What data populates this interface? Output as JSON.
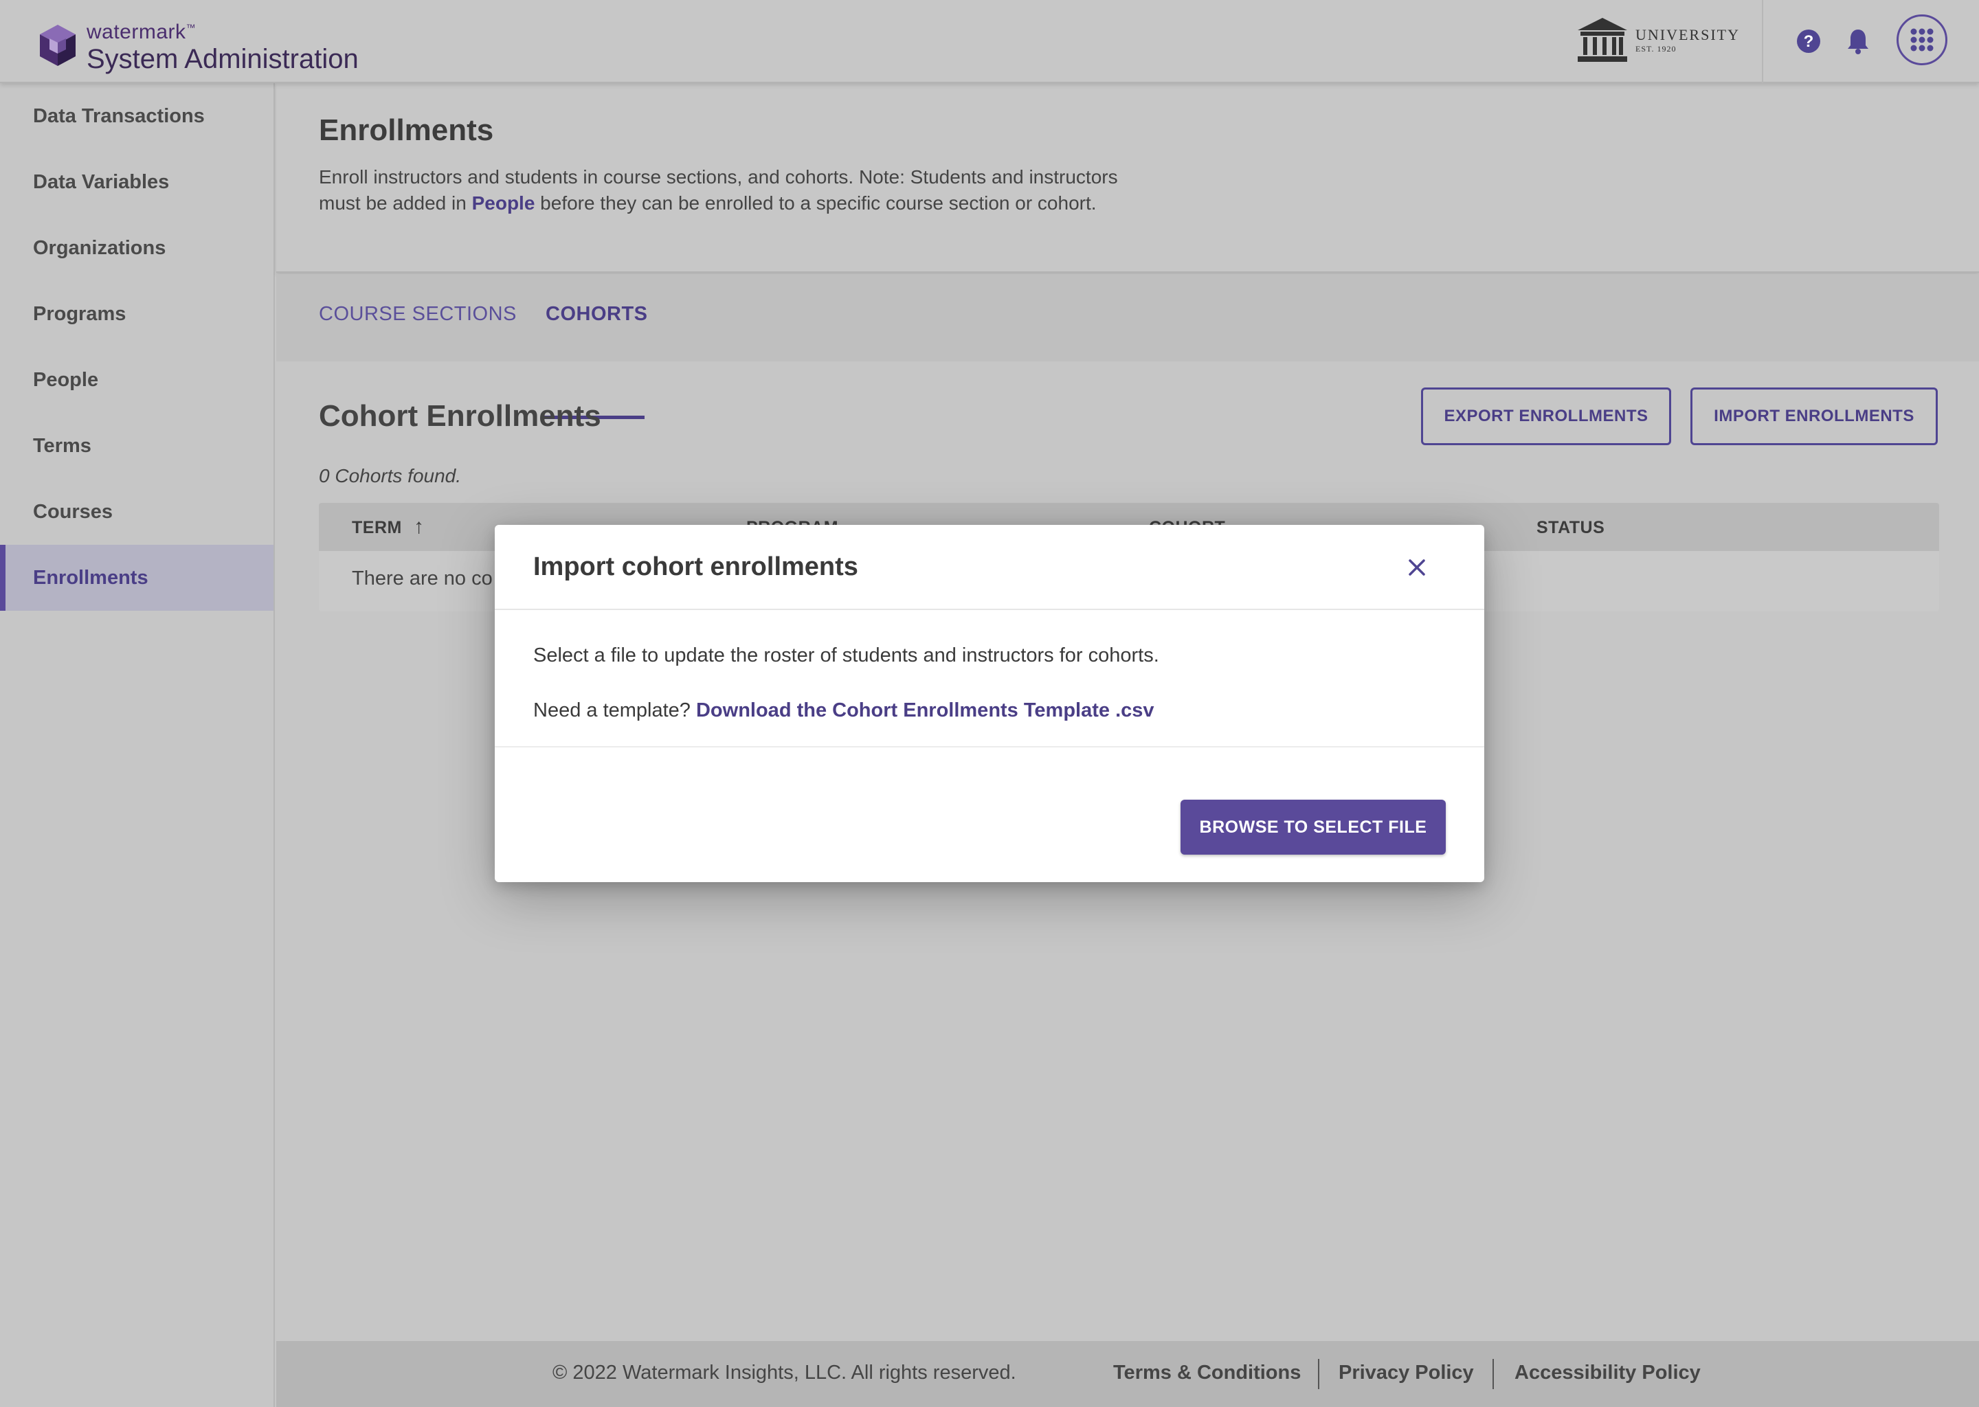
{
  "header": {
    "brand_small": "watermark",
    "brand_tm": "™",
    "brand_title": "System Administration",
    "university_name": "UNIVERSITY",
    "university_est": "EST. 1920",
    "icons": [
      "help-icon",
      "bell-icon",
      "apps-grid-icon"
    ]
  },
  "sidebar": {
    "items": [
      {
        "label": "Data Transactions"
      },
      {
        "label": "Data Variables"
      },
      {
        "label": "Organizations"
      },
      {
        "label": "Programs"
      },
      {
        "label": "People"
      },
      {
        "label": "Terms"
      },
      {
        "label": "Courses"
      },
      {
        "label": "Enrollments"
      }
    ],
    "active": "Enrollments"
  },
  "page": {
    "title": "Enrollments",
    "desc_part1": "Enroll instructors and students in course sections, and cohorts. Note: Students and instructors must be added in ",
    "desc_link": "People",
    "desc_part2": " before they can be enrolled to a specific course section or cohort."
  },
  "tabs": [
    {
      "label": "COURSE SECTIONS"
    },
    {
      "label": "COHORTS"
    }
  ],
  "section": {
    "title": "Cohort Enrollments",
    "export_label": "EXPORT ENROLLMENTS",
    "import_label": "IMPORT ENROLLMENTS",
    "found_text": "0 Cohorts found."
  },
  "table": {
    "columns": [
      "TERM",
      "PROGRAM",
      "COHORT",
      "STATUS"
    ],
    "sort_indicator": "↑",
    "empty_text": "There are no co"
  },
  "modal": {
    "title": "Import cohort enrollments",
    "body_line1": "Select a file to update the roster of students and instructors for cohorts.",
    "body_prefix": "Need a template? ",
    "download_link": "Download the Cohort Enrollments Template .csv",
    "browse_label": "BROWSE TO SELECT FILE"
  },
  "footer": {
    "copyright": "© 2022 Watermark Insights, LLC. All rights reserved.",
    "links": [
      "Terms & Conditions",
      "Privacy Policy",
      "Accessibility Policy"
    ]
  },
  "colors": {
    "accent": "#5a4a9a",
    "accent_text": "#4a3e86",
    "overlay_bg": "#c6c6c6"
  }
}
